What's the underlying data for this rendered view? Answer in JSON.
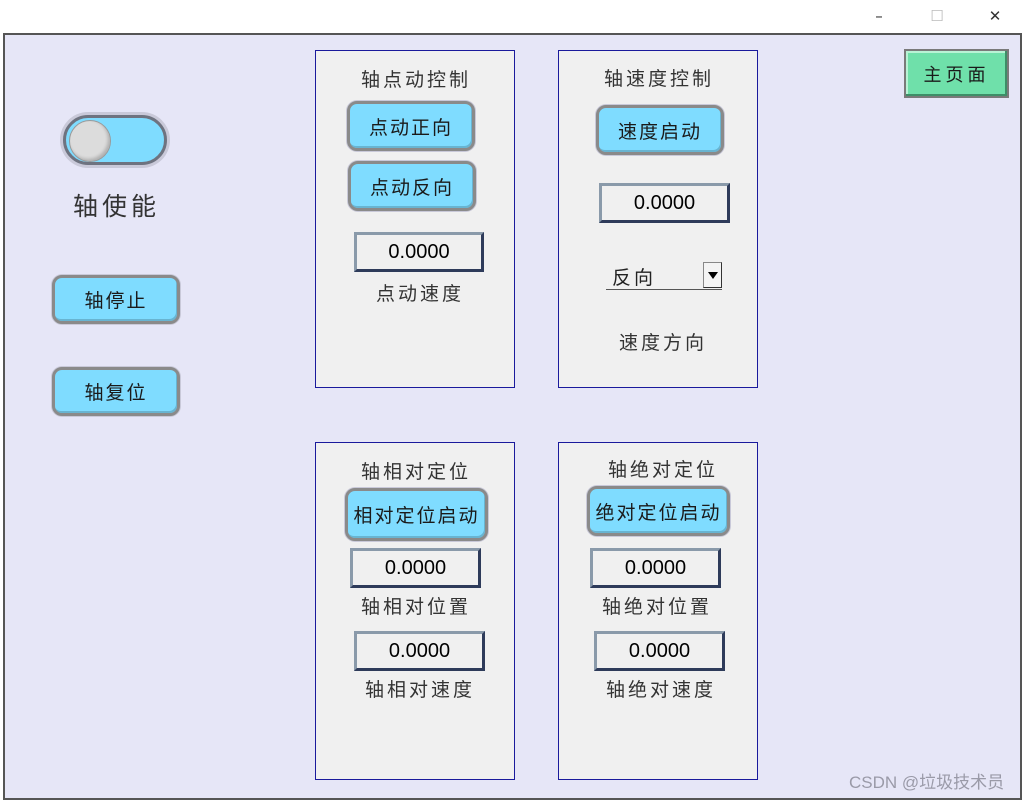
{
  "window": {
    "controls": {
      "minimize": "–",
      "maximize": "☐",
      "close": "✕"
    }
  },
  "left": {
    "toggle": {
      "on": true
    },
    "enable_label": "轴使能",
    "stop_button": "轴停止",
    "reset_button": "轴复位"
  },
  "main_button": "主页面",
  "jog_panel": {
    "title": "轴点动控制",
    "forward_button": "点动正向",
    "reverse_button": "点动反向",
    "speed_value": "0.0000",
    "speed_label": "点动速度"
  },
  "speed_panel": {
    "title": "轴速度控制",
    "start_button": "速度启动",
    "speed_value": "0.0000",
    "direction_selected": "反向",
    "direction_label": "速度方向"
  },
  "relative_panel": {
    "title": "轴相对定位",
    "start_button": "相对定位启动",
    "position_value": "0.0000",
    "position_label": "轴相对位置",
    "speed_value": "0.0000",
    "speed_label": "轴相对速度"
  },
  "absolute_panel": {
    "title": "轴绝对定位",
    "start_button": "绝对定位启动",
    "position_value": "0.0000",
    "position_label": "轴绝对位置",
    "speed_value": "0.0000",
    "speed_label": "轴绝对速度"
  },
  "watermark": "CSDN @垃圾技术员",
  "colors": {
    "client_bg": "#e6e6f7",
    "panel_bg": "#f0f0f0",
    "panel_border": "#1a1a9c",
    "button_bg": "#7fdcff",
    "main_button_bg": "#6fe0aa"
  }
}
